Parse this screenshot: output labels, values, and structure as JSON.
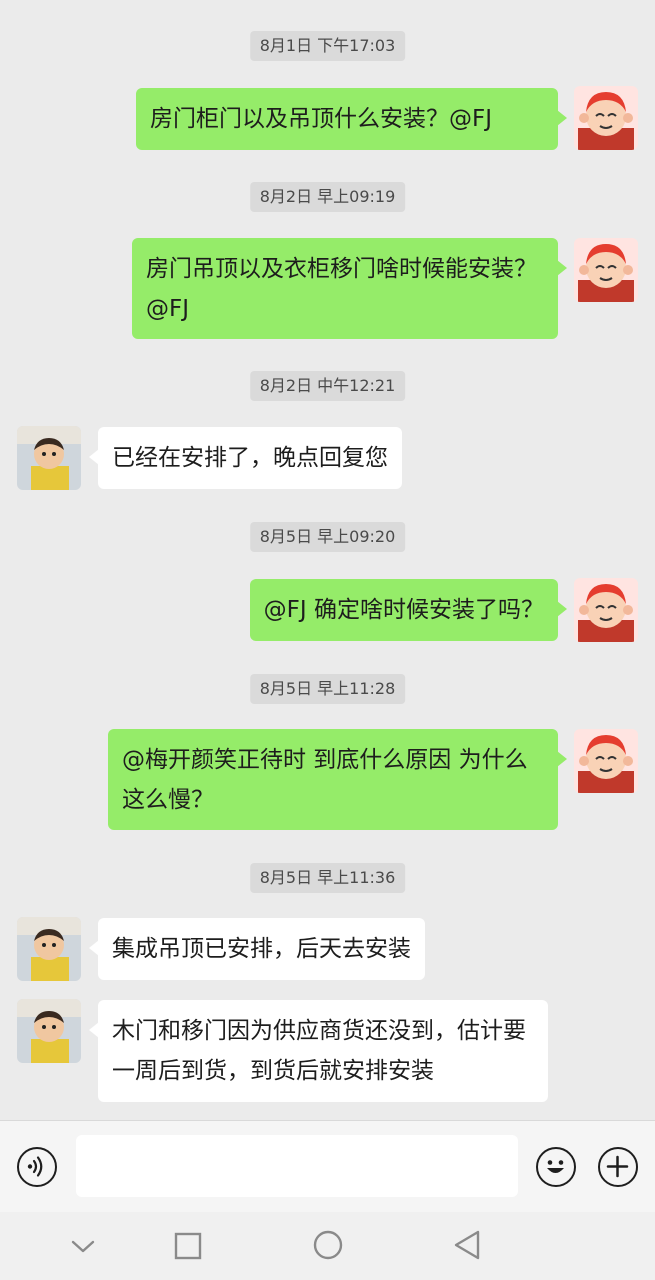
{
  "messages": [
    {
      "time": "8月1日 下午17:03",
      "side": "out",
      "text": "房门柜门以及吊顶什么安装？@FJ"
    },
    {
      "time": "8月2日 早上09:19",
      "side": "out",
      "text": "房门吊顶以及衣柜移门啥时候能安装？@FJ"
    },
    {
      "time": "8月2日 中午12:21",
      "side": "in",
      "text": "已经在安排了，晚点回复您"
    },
    {
      "time": "8月5日 早上09:20",
      "side": "out",
      "text": "@FJ 确定啥时候安装了吗？"
    },
    {
      "time": "8月5日 早上11:28",
      "side": "out",
      "text": "@梅开颜笑正待时  到底什么原因 为什么这么慢？"
    },
    {
      "time": "8月5日 早上11:36",
      "side": "in",
      "text": "集成吊顶已安排，后天去安装"
    },
    {
      "side": "in",
      "text": "木门和移门因为供应商货还没到，估计要一周后到货，到货后就安排安装"
    }
  ],
  "input": {
    "value": "",
    "placeholder": ""
  },
  "icons": {
    "voice": "voice-icon",
    "emoji": "emoji-icon",
    "plus": "plus-icon",
    "nav_back": "nav-back-icon",
    "nav_home": "nav-home-icon",
    "nav_recent": "nav-recent-icon",
    "nav_hide": "nav-hide-icon"
  },
  "colors": {
    "outgoing_bubble": "#95ec69",
    "incoming_bubble": "#ffffff",
    "chat_background": "#ebebeb",
    "timestamp_bg": "#dadada"
  }
}
